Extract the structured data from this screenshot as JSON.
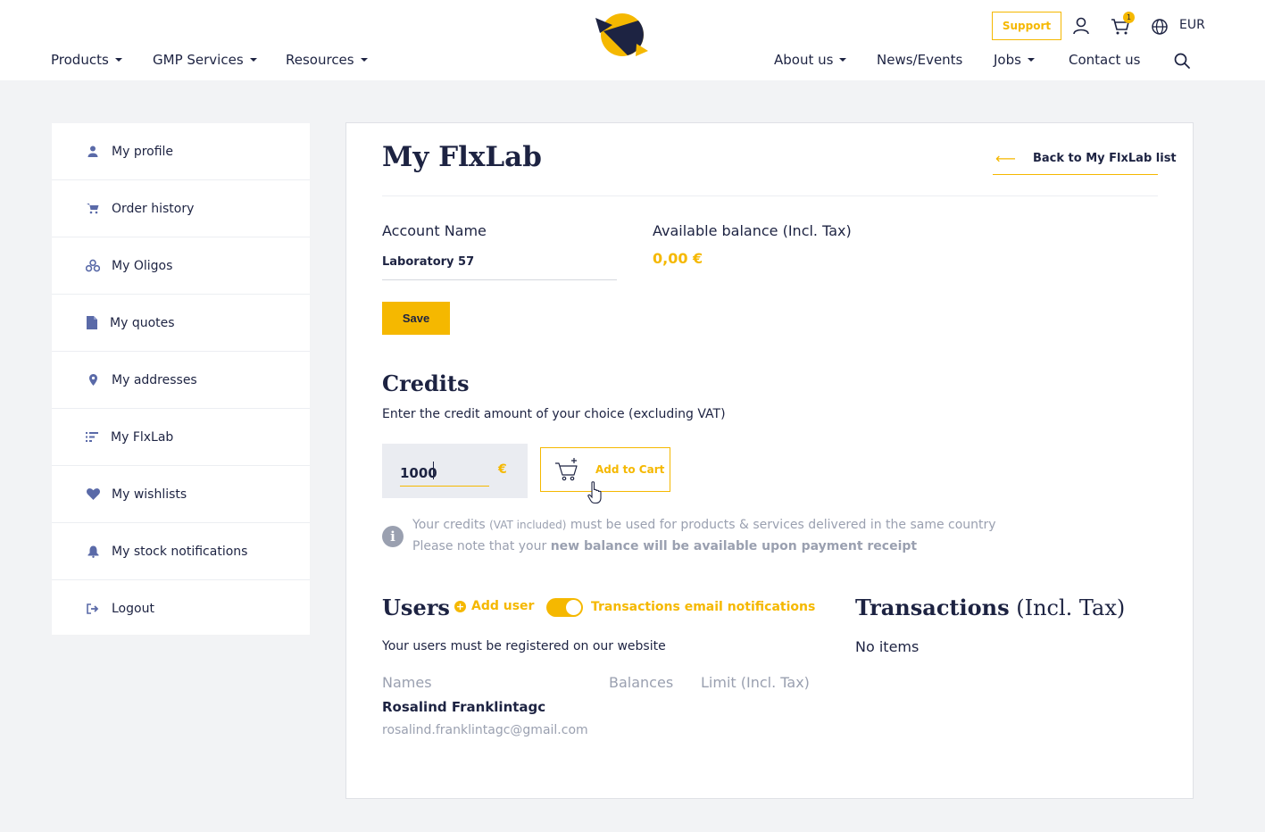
{
  "header": {
    "nav_left": [
      {
        "label": "Products"
      },
      {
        "label": "GMP Services"
      },
      {
        "label": "Resources"
      }
    ],
    "nav_right": [
      {
        "label": "About us"
      },
      {
        "label": "News/Events"
      },
      {
        "label": "Jobs"
      },
      {
        "label": "Contact us"
      }
    ],
    "support_label": "Support",
    "cart_count": "1",
    "currency": "EUR"
  },
  "sidebar": {
    "items": [
      {
        "label": "My profile",
        "icon": "user-icon"
      },
      {
        "label": "Order history",
        "icon": "cart-icon"
      },
      {
        "label": "My Oligos",
        "icon": "molecule-icon"
      },
      {
        "label": "My quotes",
        "icon": "document-icon"
      },
      {
        "label": "My addresses",
        "icon": "map-pin-icon"
      },
      {
        "label": "My FlxLab",
        "icon": "lab-list-icon"
      },
      {
        "label": "My wishlists",
        "icon": "heart-icon"
      },
      {
        "label": "My stock notifications",
        "icon": "bell-icon"
      },
      {
        "label": "Logout",
        "icon": "logout-icon"
      }
    ]
  },
  "main": {
    "title": "My FlxLab",
    "back_arrow": "⟵",
    "back_label": "Back to My FlxLab list",
    "account_name_label": "Account Name",
    "account_name_value": "Laboratory 57",
    "balance_label": "Available balance (Incl. Tax)",
    "balance_value": "0,00 €",
    "save_label": "Save"
  },
  "credits": {
    "title": "Credits",
    "description": "Enter the credit amount of your choice (excluding VAT)",
    "amount": "1000",
    "currency_symbol": "€",
    "add_to_cart_label": "Add to Cart",
    "info_icon_glyph": "i",
    "info_line1_start": "Your credits ",
    "info_line1_small": "(VAT included)",
    "info_line1_end": " must be used for products & services delivered in the same country",
    "info_line2_start": "Please note that your ",
    "info_line2_bold": "new balance will be available upon payment receipt"
  },
  "users": {
    "title": "Users",
    "add_user_label": "Add user",
    "notifications_label": "Transactions email notifications",
    "notifications_enabled": true,
    "note": "Your users must be registered on our website",
    "columns": [
      "Names",
      "Balances",
      "Limit (Incl. Tax)"
    ],
    "rows": [
      {
        "name": "Rosalind Franklintagc",
        "email": "rosalind.franklintagc@gmail.com"
      }
    ]
  },
  "transactions": {
    "title_bold": "Transactions",
    "title_suffix": " (Incl. Tax)",
    "empty_text": "No items"
  },
  "colors": {
    "accent": "#f5b800",
    "navy": "#1d2342",
    "muted": "#9aa0b0",
    "background": "#f2f3f5"
  }
}
